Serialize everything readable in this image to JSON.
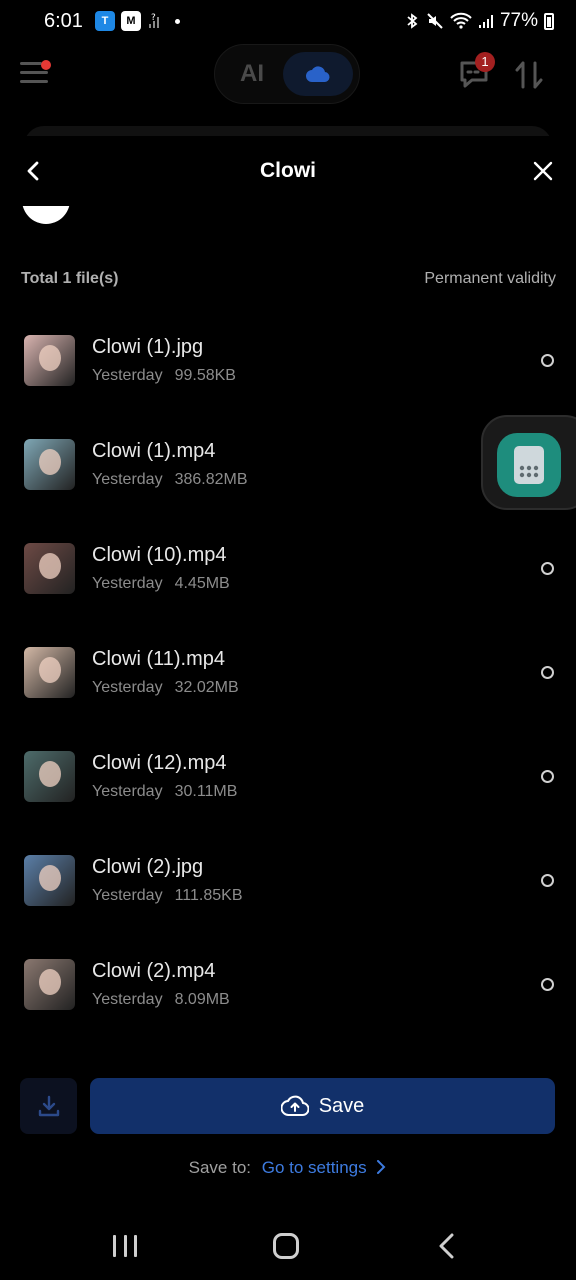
{
  "status_bar": {
    "time": "6:01",
    "battery": "77%"
  },
  "app_header": {
    "mode_ai_label": "AI",
    "chat_badge_count": "1"
  },
  "sheet": {
    "title": "Clowi",
    "summary_total": "Total 1 file(s)",
    "summary_validity": "Permanent validity"
  },
  "files": [
    {
      "name": "Clowi (1).jpg",
      "date": "Yesterday",
      "size": "99.58KB",
      "thumb_color": "#d9b4b0"
    },
    {
      "name": "Clowi (1).mp4",
      "date": "Yesterday",
      "size": "386.82MB",
      "thumb_color": "#7fa7b5"
    },
    {
      "name": "Clowi (10).mp4",
      "date": "Yesterday",
      "size": "4.45MB",
      "thumb_color": "#6d4a45"
    },
    {
      "name": "Clowi (11).mp4",
      "date": "Yesterday",
      "size": "32.02MB",
      "thumb_color": "#d3b8a6"
    },
    {
      "name": "Clowi (12).mp4",
      "date": "Yesterday",
      "size": "30.11MB",
      "thumb_color": "#4d6b6a"
    },
    {
      "name": "Clowi (2).jpg",
      "date": "Yesterday",
      "size": "111.85KB",
      "thumb_color": "#5b7fa8"
    },
    {
      "name": "Clowi (2).mp4",
      "date": "Yesterday",
      "size": "8.09MB",
      "thumb_color": "#8a7870"
    }
  ],
  "actions": {
    "save_label": "Save",
    "save_to_label": "Save to:",
    "save_to_link": "Go to settings"
  },
  "colors": {
    "accent_blue": "#3d7be0",
    "save_button": "#12306a",
    "float_widget": "#1e8d7d"
  }
}
